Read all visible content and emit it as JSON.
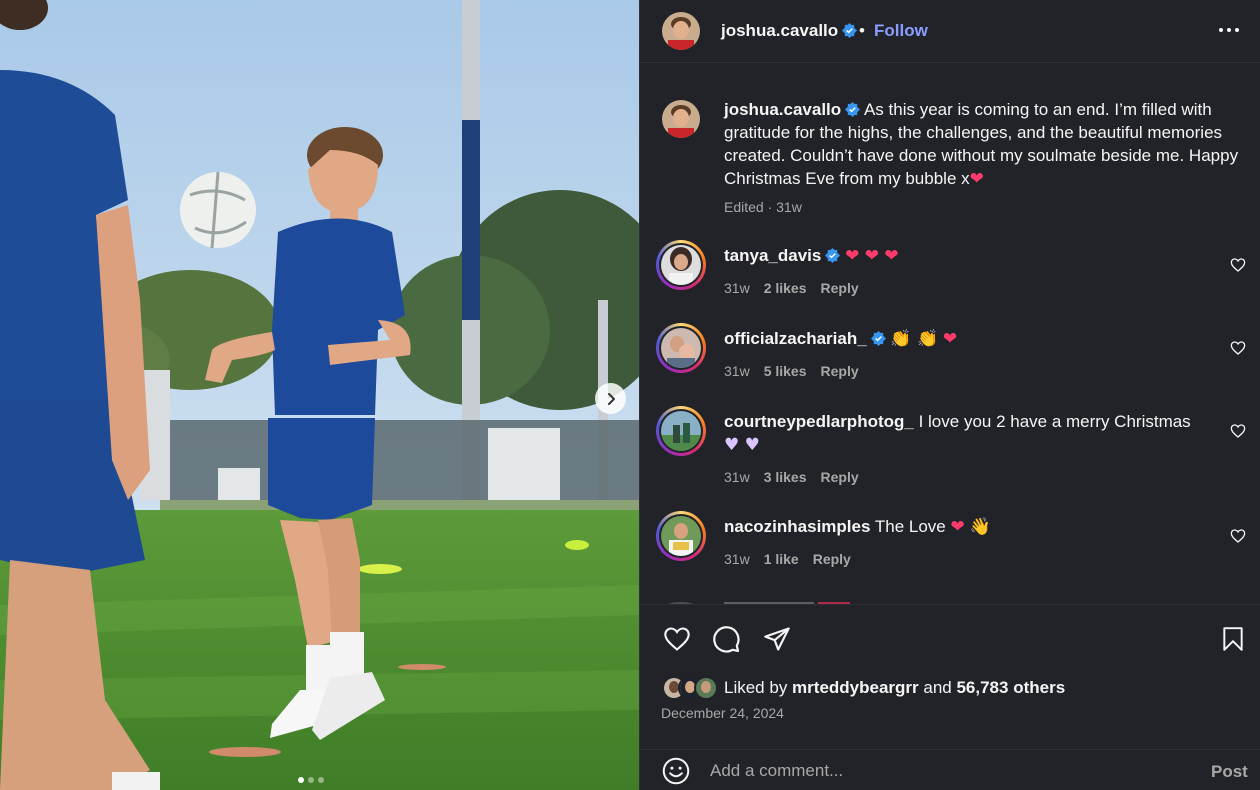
{
  "post": {
    "author": "joshua.cavallo",
    "follow_label": "Follow",
    "separator": "•",
    "image_alt": "Soccer player in blue training kit juggling a ball on a training pitch",
    "carousel": {
      "total": 3,
      "active": 1
    }
  },
  "caption": {
    "author": "joshua.cavallo",
    "text": " As this year is coming to an end. I’m filled with gratitude for the highs, the challenges, and the beautiful memories created. Couldn’t have done without my soulmate beside me. Happy Christmas Eve from my bubble x",
    "emoji": "❤",
    "meta": "Edited · 31w"
  },
  "comments": [
    {
      "user": "tanya_davis",
      "verified": true,
      "text": "",
      "emojis": "❤ ❤ ❤",
      "age": "31w",
      "likes": "2 likes",
      "reply": "Reply"
    },
    {
      "user": "officialzachariah_",
      "verified": true,
      "text": "",
      "emojis_clap": "👏 👏",
      "emojis_heart": "❤",
      "age": "31w",
      "likes": "5 likes",
      "reply": "Reply"
    },
    {
      "user": "courtneypedlarphotog_",
      "verified": false,
      "text": " I love you 2 have a merry Christmas",
      "emojis": "♥ ♥",
      "age": "31w",
      "likes": "3 likes",
      "reply": "Reply"
    },
    {
      "user": "nacozinhasimples",
      "verified": false,
      "text": " The Love ",
      "emojis_heart": "❤",
      "emojis_hand": "👋",
      "age": "31w",
      "likes": "1 like",
      "reply": "Reply"
    }
  ],
  "engagement": {
    "liked_prefix": "Liked by ",
    "liked_user": "mrteddybeargrr",
    "liked_mid": " and ",
    "liked_count": "56,783 others",
    "date": "December 24, 2024"
  },
  "composer": {
    "placeholder": "Add a comment...",
    "post_label": "Post"
  },
  "icons": {
    "like": "heart-icon",
    "comment": "comment-icon",
    "share": "share-icon",
    "save": "bookmark-icon",
    "emoji": "smile-icon",
    "more": "more-icon",
    "next": "chevron-right-icon",
    "verified": "verified-badge-icon"
  },
  "colors": {
    "panel_bg": "#212328",
    "follow": "#8b9cff",
    "verified": "#3797f0",
    "muted": "#a8a8a8"
  }
}
